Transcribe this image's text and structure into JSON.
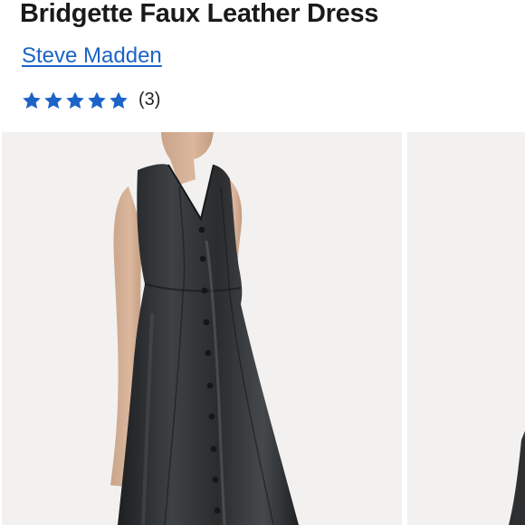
{
  "product": {
    "title": "Bridgette Faux Leather Dress",
    "brand": "Steve Madden",
    "rating": {
      "stars": 5,
      "max_stars": 5,
      "review_count_label": "(3)",
      "star_color": "#1c63c7",
      "star_icon": "star-icon"
    }
  },
  "gallery": {
    "images": [
      {
        "subject": "model wearing black faux leather button-front dress"
      },
      {
        "subject": "next gallery image (partially visible)"
      }
    ]
  },
  "colors": {
    "link": "#1c63c7",
    "title": "#1a1a1a",
    "image_background": "#f2f1ef",
    "dress": "#2b2d2f"
  }
}
